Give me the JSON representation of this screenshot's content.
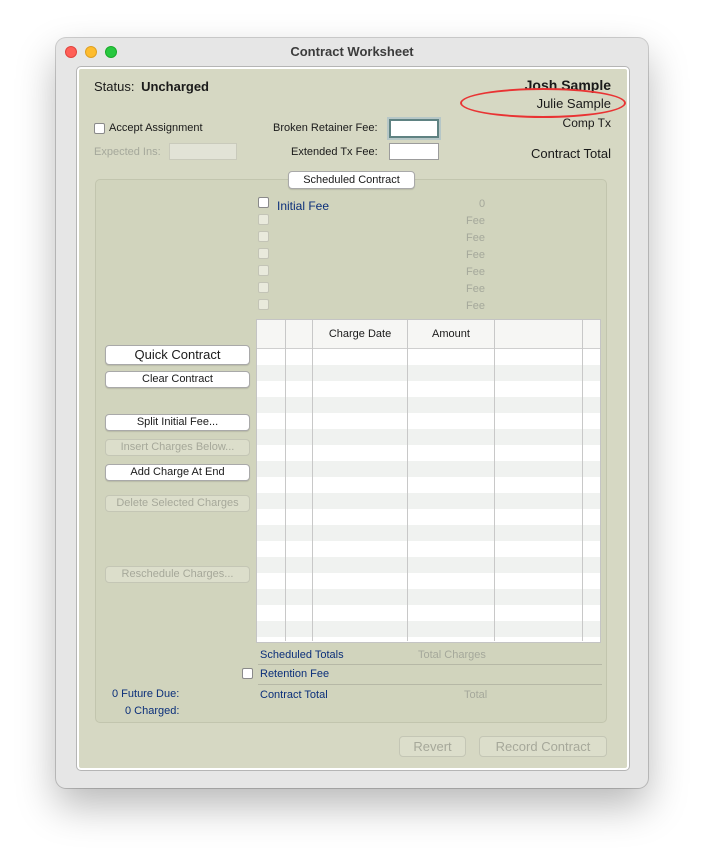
{
  "window": {
    "title": "Contract Worksheet"
  },
  "header": {
    "status_label": "Status:",
    "status_value": "Uncharged",
    "patient_name": "Josh Sample",
    "responsible_party": "Julie Sample",
    "comp_tx": "Comp Tx",
    "contract_total": "Contract Total"
  },
  "form": {
    "accept_assignment": "Accept Assignment",
    "expected_ins": "Expected Ins:",
    "broken_retainer_fee": "Broken Retainer Fee:",
    "extended_tx_fee": "Extended Tx Fee:"
  },
  "scheduled_contract_button": "Scheduled Contract",
  "fees": {
    "initial_fee_label": "Initial Fee",
    "initial_fee_value": "0",
    "rows": [
      "Fee",
      "Fee",
      "Fee",
      "Fee",
      "Fee",
      "Fee"
    ]
  },
  "buttons": {
    "quick_contract": "Quick Contract",
    "clear_contract": "Clear Contract",
    "split_initial_fee": "Split Initial Fee...",
    "insert_charges_below": "Insert Charges Below...",
    "add_charge_at_end": "Add Charge At End",
    "delete_selected_charges": "Delete Selected Charges",
    "reschedule_charges": "Reschedule Charges...",
    "revert": "Revert",
    "record_contract": "Record Contract"
  },
  "table": {
    "columns": [
      "",
      "",
      "Charge Date",
      "Amount",
      ""
    ],
    "rows": []
  },
  "totals": {
    "scheduled_totals": "Scheduled Totals",
    "total_charges": "Total Charges",
    "retention_fee": "Retention Fee",
    "contract_total": "Contract Total",
    "total": "Total",
    "future_due": "0 Future Due:",
    "charged": "0 Charged:"
  },
  "colors": {
    "panel_bg": "#d6d8c3",
    "link_blue": "#0b2f7a",
    "highlight_red": "#e93333"
  }
}
